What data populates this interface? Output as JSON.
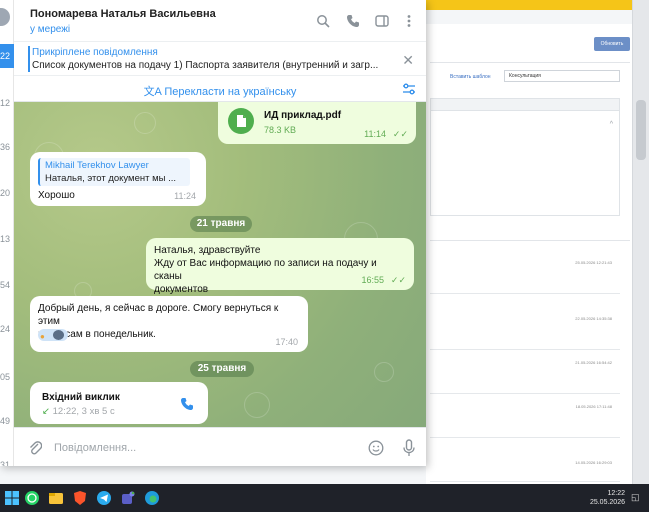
{
  "background_page": {
    "button_label": "Обновить",
    "insert_template_link": "Вставить шаблон",
    "select_value": "Консультация",
    "row_dates": [
      "25.05.2026 12:21:43",
      "22.05.2026 14:35:38",
      "21.05.2026 16:54:42",
      "18.05.2026 17:11:48",
      "14.05.2026 16:29:03"
    ]
  },
  "sidebar": {
    "numbers": [
      "22",
      "12",
      "36",
      "20",
      "13",
      "54",
      "24",
      "05",
      "49",
      "31"
    ]
  },
  "header": {
    "chat_name": "Пономарева Наталья Васильевна",
    "status": "у мережі"
  },
  "pinned": {
    "title": "Прикріплене повідомлення",
    "text": "Список документов на подачу  1) Паспорта заявителя (внутренний и загр..."
  },
  "translate_label": "Перекласти на українську",
  "messages": {
    "file": {
      "name": "ИД приклад.pdf",
      "size": "78.3 KB",
      "time": "11:14"
    },
    "reply": {
      "quote_author": "Mikhail Terekhov Lawyer",
      "quote_text": "Наталья, этот документ мы ...",
      "text": "Хорошо",
      "time": "11:24"
    },
    "date1": "21 травня",
    "out_msg": {
      "line1": "Наталья, здравствуйте",
      "line2": "Жду от Вас информацию по записи на подачу и сканы",
      "line3": "документов",
      "time": "16:55"
    },
    "in_msg": {
      "line1": "Добрый день, я сейчас в дороге. Смогу вернуться к этим",
      "line2": "вопросам в понедельник.",
      "time": "17:40"
    },
    "date2": "25 травня",
    "call": {
      "title": "Вхідний виклик",
      "detail": "12:22, 3 хв 5 с"
    }
  },
  "composer": {
    "placeholder": "Повідомлення..."
  },
  "taskbar": {
    "time": "12:22",
    "date": "25.05.2026"
  },
  "colors": {
    "accent": "#3390ec",
    "outgoing_bubble": "#effdde",
    "read_check": "#62ac55",
    "call_green": "#4fae4e"
  }
}
